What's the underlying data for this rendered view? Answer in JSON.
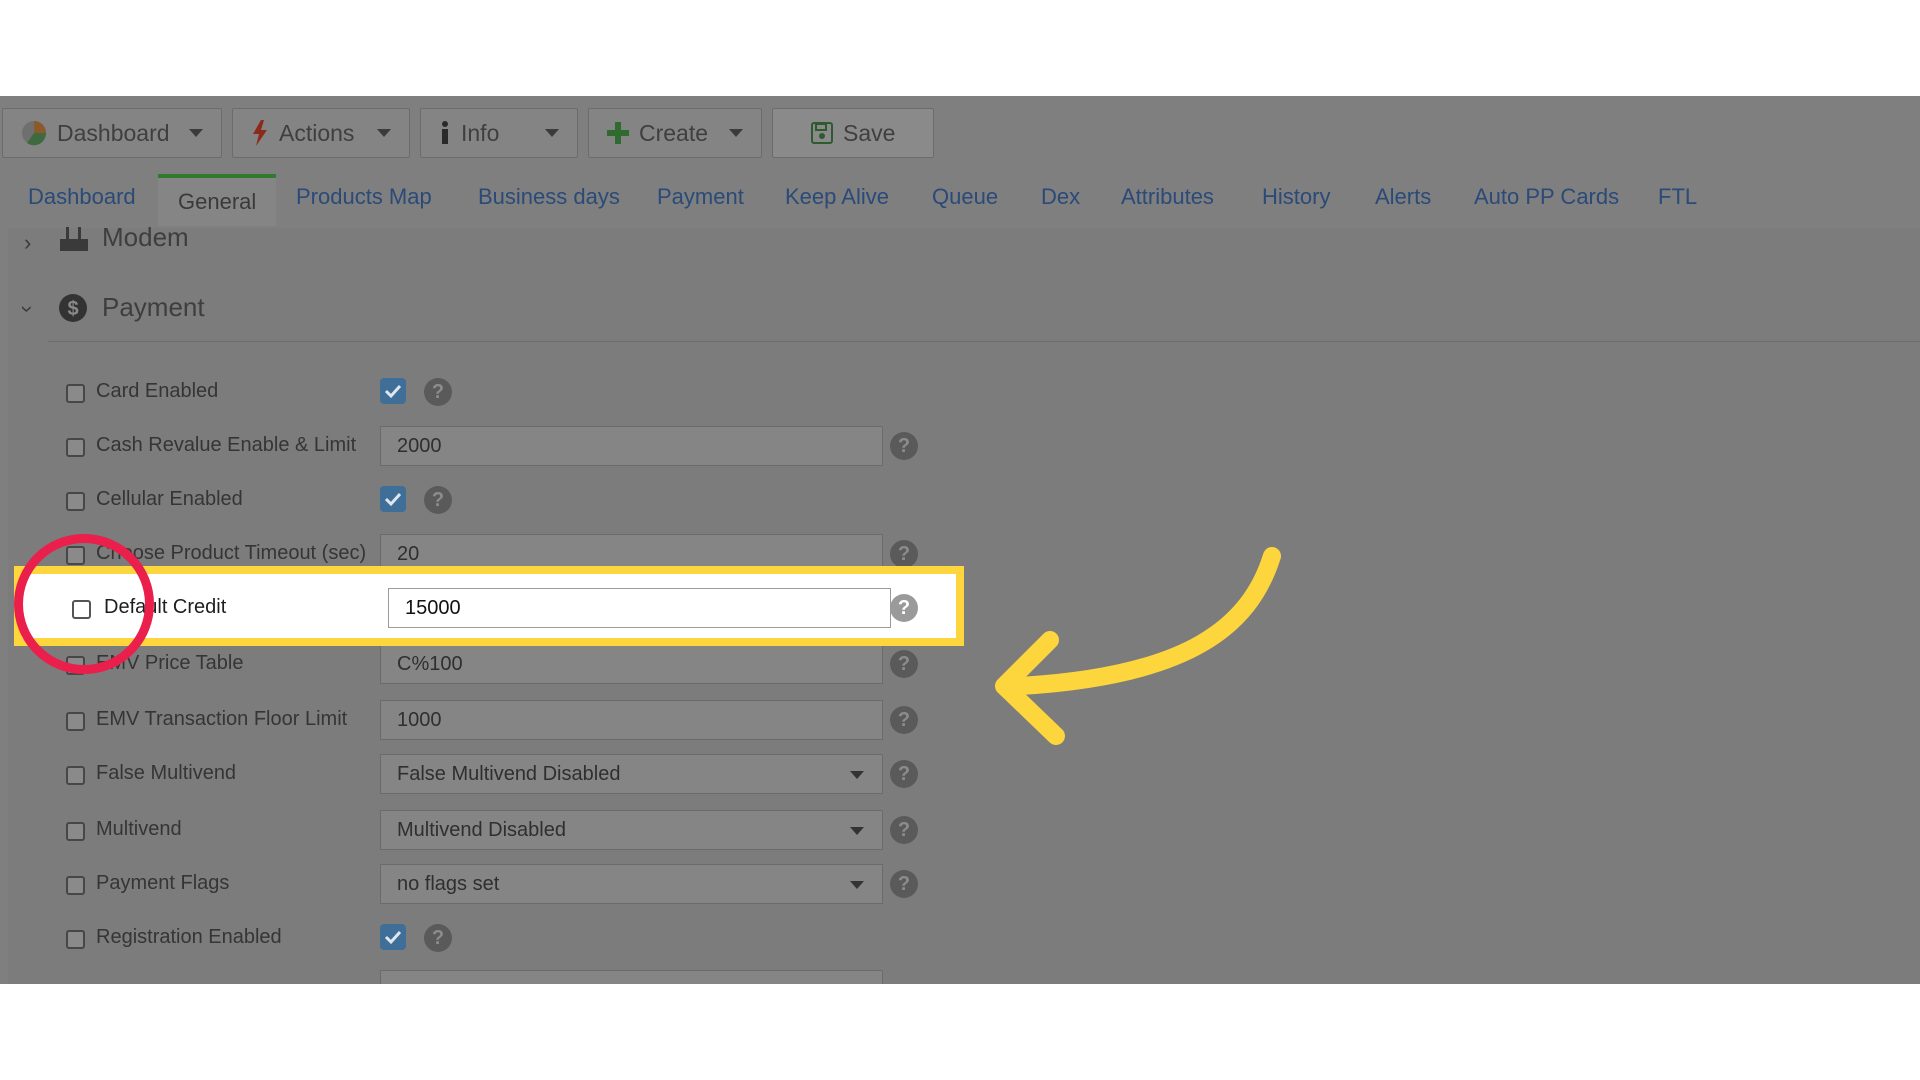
{
  "toolbar": {
    "dashboard_label": "Dashboard",
    "actions_label": "Actions",
    "info_label": "Info",
    "create_label": "Create",
    "save_label": "Save"
  },
  "tabs": [
    "Dashboard",
    "General",
    "Products Map",
    "Business days",
    "Payment",
    "Keep Alive",
    "Queue",
    "Dex",
    "Attributes",
    "History",
    "Alerts",
    "Auto PP Cards",
    "FTL"
  ],
  "active_tab": "General",
  "sections": {
    "modem": "Modem",
    "payment": "Payment"
  },
  "rows": {
    "card_enabled": {
      "label": "Card Enabled",
      "checked": true
    },
    "cash_revalue": {
      "label": "Cash Revalue Enable & Limit",
      "value": "2000"
    },
    "cellular_enabled": {
      "label": "Cellular Enabled",
      "checked": true
    },
    "choose_product_timeout": {
      "label": "Choose Product Timeout (sec)",
      "value": "20"
    },
    "default_credit": {
      "label": "Default Credit",
      "value": "15000"
    },
    "emv_price_table": {
      "label": "EMV Price Table",
      "value": "C%100"
    },
    "emv_floor_limit": {
      "label": "EMV Transaction Floor Limit",
      "value": "1000"
    },
    "false_multivend": {
      "label": "False Multivend",
      "value": "False Multivend Disabled"
    },
    "multivend": {
      "label": "Multivend",
      "value": "Multivend Disabled"
    },
    "payment_flags": {
      "label": "Payment Flags",
      "value": "no flags set"
    },
    "registration_enabled": {
      "label": "Registration Enabled",
      "checked": true
    }
  },
  "help_glyph": "?",
  "colors": {
    "highlight": "#fdd53d",
    "ring": "#ea1f4b",
    "arrow": "#fdd53d",
    "active_tab_accent": "#2f7a2f"
  }
}
